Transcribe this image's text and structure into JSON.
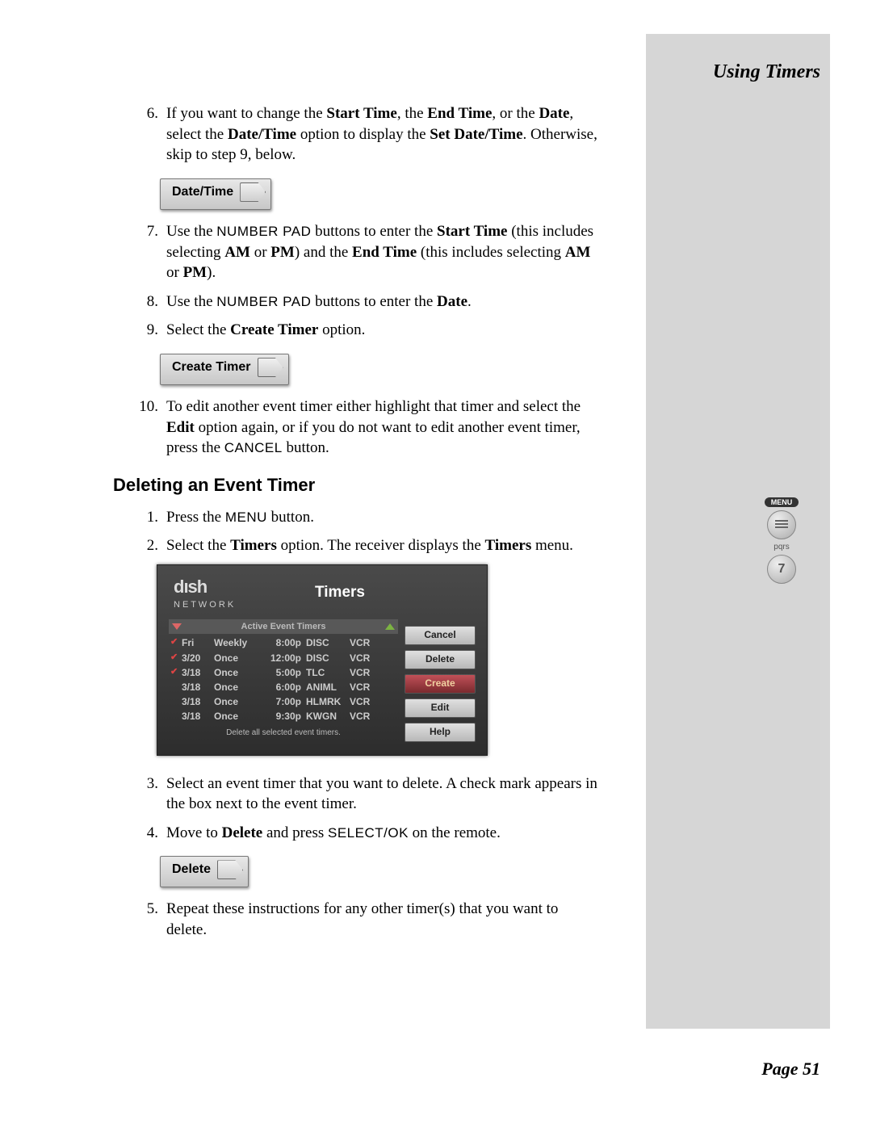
{
  "header": "Using Timers",
  "footer": "Page 51",
  "steps_a": [
    {
      "n": "6.",
      "parts": [
        {
          "t": "If you want to change the "
        },
        {
          "t": "Start Time",
          "b": true
        },
        {
          "t": ", the "
        },
        {
          "t": "End Time",
          "b": true
        },
        {
          "t": ", or the "
        },
        {
          "t": "Date",
          "b": true
        },
        {
          "t": ", select the "
        },
        {
          "t": "Date/Time",
          "b": true
        },
        {
          "t": " option to display the "
        },
        {
          "t": "Set Date/Time",
          "b": true
        },
        {
          "t": ". Otherwise, skip to step 9, below."
        }
      ]
    }
  ],
  "btn_datetime": "Date/Time",
  "steps_b": [
    {
      "n": "7.",
      "parts": [
        {
          "t": "Use the "
        },
        {
          "t": "NUMBER PAD",
          "sc": true
        },
        {
          "t": " buttons to enter the "
        },
        {
          "t": "Start Time",
          "b": true
        },
        {
          "t": " (this includes selecting "
        },
        {
          "t": "AM",
          "b": true
        },
        {
          "t": " or "
        },
        {
          "t": "PM",
          "b": true
        },
        {
          "t": ") and the "
        },
        {
          "t": "End Time",
          "b": true
        },
        {
          "t": " (this includes selecting "
        },
        {
          "t": "AM",
          "b": true
        },
        {
          "t": " or "
        },
        {
          "t": "PM",
          "b": true
        },
        {
          "t": ")."
        }
      ]
    },
    {
      "n": "8.",
      "parts": [
        {
          "t": "Use the "
        },
        {
          "t": "NUMBER PAD",
          "sc": true
        },
        {
          "t": " buttons to enter the "
        },
        {
          "t": "Date",
          "b": true
        },
        {
          "t": "."
        }
      ]
    },
    {
      "n": "9.",
      "parts": [
        {
          "t": "Select the "
        },
        {
          "t": "Create Timer",
          "b": true
        },
        {
          "t": " option."
        }
      ]
    }
  ],
  "btn_create": "Create Timer",
  "steps_c": [
    {
      "n": "10.",
      "parts": [
        {
          "t": "To edit another event timer either highlight that timer and select the "
        },
        {
          "t": "Edit",
          "b": true
        },
        {
          "t": " option again, or if you do not want to edit another event timer, press the "
        },
        {
          "t": "CANCEL",
          "sc": true
        },
        {
          "t": " button."
        }
      ]
    }
  ],
  "h2": "Deleting an Event Timer",
  "steps_d": [
    {
      "n": "1.",
      "parts": [
        {
          "t": "Press the "
        },
        {
          "t": "MENU",
          "sc": true
        },
        {
          "t": " button."
        }
      ]
    },
    {
      "n": "2.",
      "parts": [
        {
          "t": "Select the "
        },
        {
          "t": "Timers",
          "b": true
        },
        {
          "t": " option. The receiver displays the "
        },
        {
          "t": "Timers",
          "b": true
        },
        {
          "t": " menu."
        }
      ]
    }
  ],
  "timers_shot": {
    "logo_top": "dısh",
    "logo_sub": "N E T W O R K",
    "title": "Timers",
    "header": "Active Event Timers",
    "rows": [
      {
        "chk": true,
        "day": "Fri",
        "freq": "Weekly",
        "time": "8:00p",
        "ch": "DISC",
        "rec": "VCR"
      },
      {
        "chk": true,
        "day": "3/20",
        "freq": "Once",
        "time": "12:00p",
        "ch": "DISC",
        "rec": "VCR"
      },
      {
        "chk": true,
        "day": "3/18",
        "freq": "Once",
        "time": "5:00p",
        "ch": "TLC",
        "rec": "VCR"
      },
      {
        "chk": false,
        "day": "3/18",
        "freq": "Once",
        "time": "6:00p",
        "ch": "ANIML",
        "rec": "VCR"
      },
      {
        "chk": false,
        "day": "3/18",
        "freq": "Once",
        "time": "7:00p",
        "ch": "HLMRK",
        "rec": "VCR"
      },
      {
        "chk": false,
        "day": "3/18",
        "freq": "Once",
        "time": "9:30p",
        "ch": "KWGN",
        "rec": "VCR"
      }
    ],
    "footer": "Delete all selected event timers.",
    "buttons": [
      "Cancel",
      "Delete",
      "Create",
      "Edit",
      "Help"
    ],
    "selected_button": "Create"
  },
  "steps_e": [
    {
      "n": "3.",
      "parts": [
        {
          "t": "Select an event timer that you want to delete. A check mark appears in the box next to the event timer."
        }
      ]
    },
    {
      "n": "4.",
      "parts": [
        {
          "t": "Move to "
        },
        {
          "t": "Delete",
          "b": true
        },
        {
          "t": " and press "
        },
        {
          "t": "SELECT/OK",
          "sc": true
        },
        {
          "t": " on the remote."
        }
      ]
    }
  ],
  "btn_delete": "Delete",
  "steps_f": [
    {
      "n": "5.",
      "parts": [
        {
          "t": "Repeat these instructions for any other timer(s) that you want to delete."
        }
      ]
    }
  ],
  "remote": {
    "menu": "MENU",
    "pqrs": "pqrs",
    "seven": "7"
  }
}
